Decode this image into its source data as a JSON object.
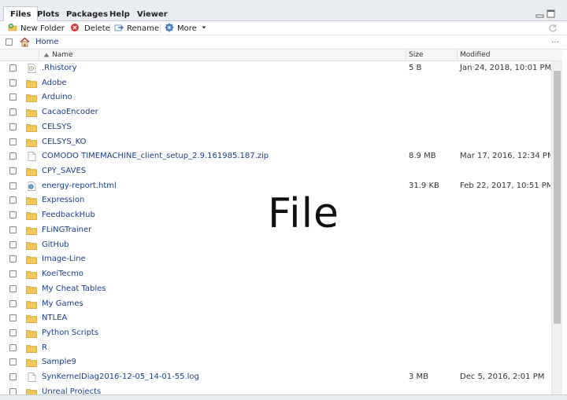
{
  "tabs": [
    {
      "label": "Files",
      "active": true
    },
    {
      "label": "Plots",
      "active": false
    },
    {
      "label": "Packages",
      "active": false
    },
    {
      "label": "Help",
      "active": false
    },
    {
      "label": "Viewer",
      "active": false
    }
  ],
  "toolbar": {
    "new_folder": "New Folder",
    "delete": "Delete",
    "rename": "Rename",
    "more": "More"
  },
  "path": {
    "home": "Home"
  },
  "columns": {
    "name": "Name",
    "size": "Size",
    "modified": "Modified"
  },
  "overlay": "File",
  "files": [
    {
      "name": ".Rhistory",
      "type": "history",
      "size": "5 B",
      "modified": "Jan 24, 2018, 10:01 PM"
    },
    {
      "name": "Adobe",
      "type": "folder",
      "size": "",
      "modified": ""
    },
    {
      "name": "Arduino",
      "type": "folder",
      "size": "",
      "modified": ""
    },
    {
      "name": "CacaoEncoder",
      "type": "folder",
      "size": "",
      "modified": ""
    },
    {
      "name": "CELSYS",
      "type": "folder",
      "size": "",
      "modified": ""
    },
    {
      "name": "CELSYS_KO",
      "type": "folder",
      "size": "",
      "modified": ""
    },
    {
      "name": "COMODO TIMEMACHINE_client_setup_2.9.161985.187.zip",
      "type": "file",
      "size": "8.9 MB",
      "modified": "Mar 17, 2016, 12:34 PM"
    },
    {
      "name": "CPY_SAVES",
      "type": "folder",
      "size": "",
      "modified": ""
    },
    {
      "name": "energy-report.html",
      "type": "html",
      "size": "31.9 KB",
      "modified": "Feb 22, 2017, 10:51 PM"
    },
    {
      "name": "Expression",
      "type": "folder",
      "size": "",
      "modified": ""
    },
    {
      "name": "FeedbackHub",
      "type": "folder",
      "size": "",
      "modified": ""
    },
    {
      "name": "FLiNGTrainer",
      "type": "folder",
      "size": "",
      "modified": ""
    },
    {
      "name": "GitHub",
      "type": "folder",
      "size": "",
      "modified": ""
    },
    {
      "name": "Image-Line",
      "type": "folder",
      "size": "",
      "modified": ""
    },
    {
      "name": "KoeiTecmo",
      "type": "folder",
      "size": "",
      "modified": ""
    },
    {
      "name": "My Cheat Tables",
      "type": "folder",
      "size": "",
      "modified": ""
    },
    {
      "name": "My Games",
      "type": "folder",
      "size": "",
      "modified": ""
    },
    {
      "name": "NTLEA",
      "type": "folder",
      "size": "",
      "modified": ""
    },
    {
      "name": "Python Scripts",
      "type": "folder",
      "size": "",
      "modified": ""
    },
    {
      "name": "R",
      "type": "folder",
      "size": "",
      "modified": ""
    },
    {
      "name": "Sample9",
      "type": "folder",
      "size": "",
      "modified": ""
    },
    {
      "name": "SynKernelDiag2016-12-05_14-01-55.log",
      "type": "file",
      "size": "3 MB",
      "modified": "Dec 5, 2016, 2:01 PM"
    },
    {
      "name": "Unreal Projects",
      "type": "folder",
      "size": "",
      "modified": ""
    }
  ]
}
